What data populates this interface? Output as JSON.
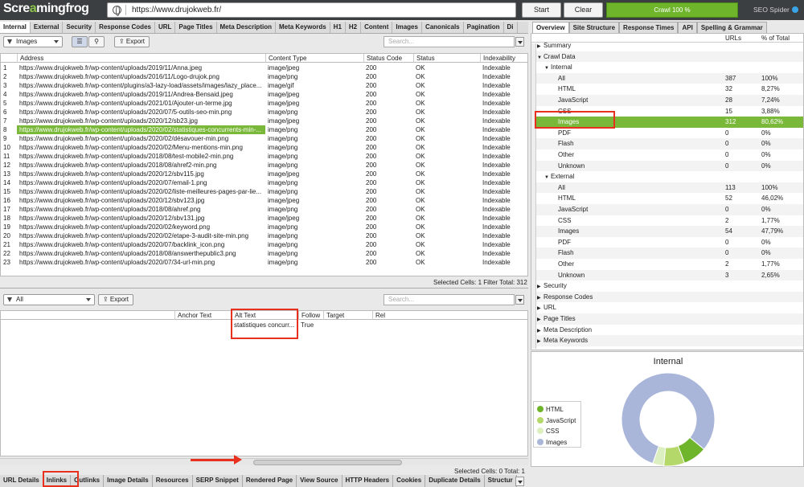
{
  "app": {
    "logo_left": "Scre",
    "logo_o": "a",
    "logo_right": "mingfrog",
    "url": "https://www.drujokweb.fr/",
    "start": "Start",
    "clear": "Clear",
    "progress": "Crawl 100 %",
    "seo_spider": "SEO Spider"
  },
  "top_tabs": [
    "Internal",
    "External",
    "Security",
    "Response Codes",
    "URL",
    "Page Titles",
    "Meta Description",
    "Meta Keywords",
    "H1",
    "H2",
    "Content",
    "Images",
    "Canonicals",
    "Pagination",
    "Di"
  ],
  "filter": {
    "value": "Images",
    "export": "Export",
    "search_placeholder": "Search..."
  },
  "columns": [
    "Address",
    "Content Type",
    "Status Code",
    "Status",
    "Indexability"
  ],
  "rows": [
    [
      "1",
      "https://www.drujokweb.fr/wp-content/uploads/2019/11/Anna.jpeg",
      "image/jpeg",
      "200",
      "OK",
      "Indexable"
    ],
    [
      "2",
      "https://www.drujokweb.fr/wp-content/uploads/2016/11/Logo-drujok.png",
      "image/png",
      "200",
      "OK",
      "Indexable"
    ],
    [
      "3",
      "https://www.drujokweb.fr/wp-content/plugins/a3-lazy-load/assets/images/lazy_place...",
      "image/gif",
      "200",
      "OK",
      "Indexable"
    ],
    [
      "4",
      "https://www.drujokweb.fr/wp-content/uploads/2019/11/Andrea-Bensaid.jpeg",
      "image/jpeg",
      "200",
      "OK",
      "Indexable"
    ],
    [
      "5",
      "https://www.drujokweb.fr/wp-content/uploads/2021/01/Ajouter-un-terme.jpg",
      "image/jpeg",
      "200",
      "OK",
      "Indexable"
    ],
    [
      "6",
      "https://www.drujokweb.fr/wp-content/uploads/2020/07/5-outils-seo-min.png",
      "image/png",
      "200",
      "OK",
      "Indexable"
    ],
    [
      "7",
      "https://www.drujokweb.fr/wp-content/uploads/2020/12/sb23.jpg",
      "image/jpeg",
      "200",
      "OK",
      "Indexable"
    ],
    [
      "8",
      "https://www.drujokweb.fr/wp-content/uploads/2020/02/statistiques-concurrents-min-...",
      "image/png",
      "200",
      "OK",
      "Indexable"
    ],
    [
      "9",
      "https://www.drujokweb.fr/wp-content/uploads/2020/02/désavouer-min.png",
      "image/png",
      "200",
      "OK",
      "Indexable"
    ],
    [
      "10",
      "https://www.drujokweb.fr/wp-content/uploads/2020/02/Menu-mentions-min.png",
      "image/png",
      "200",
      "OK",
      "Indexable"
    ],
    [
      "11",
      "https://www.drujokweb.fr/wp-content/uploads/2018/08/test-mobile2-min.png",
      "image/png",
      "200",
      "OK",
      "Indexable"
    ],
    [
      "12",
      "https://www.drujokweb.fr/wp-content/uploads/2018/08/ahref2-min.png",
      "image/png",
      "200",
      "OK",
      "Indexable"
    ],
    [
      "13",
      "https://www.drujokweb.fr/wp-content/uploads/2020/12/sbv115.jpg",
      "image/jpeg",
      "200",
      "OK",
      "Indexable"
    ],
    [
      "14",
      "https://www.drujokweb.fr/wp-content/uploads/2020/07/email-1.png",
      "image/png",
      "200",
      "OK",
      "Indexable"
    ],
    [
      "15",
      "https://www.drujokweb.fr/wp-content/uploads/2020/02/liste-meilleures-pages-par-lie...",
      "image/png",
      "200",
      "OK",
      "Indexable"
    ],
    [
      "16",
      "https://www.drujokweb.fr/wp-content/uploads/2020/12/sbv123.jpg",
      "image/jpeg",
      "200",
      "OK",
      "Indexable"
    ],
    [
      "17",
      "https://www.drujokweb.fr/wp-content/uploads/2018/08/ahref.png",
      "image/png",
      "200",
      "OK",
      "Indexable"
    ],
    [
      "18",
      "https://www.drujokweb.fr/wp-content/uploads/2020/12/sbv131.jpg",
      "image/jpeg",
      "200",
      "OK",
      "Indexable"
    ],
    [
      "19",
      "https://www.drujokweb.fr/wp-content/uploads/2020/02/keyword.png",
      "image/png",
      "200",
      "OK",
      "Indexable"
    ],
    [
      "20",
      "https://www.drujokweb.fr/wp-content/uploads/2020/02/etape-3-audit-site-min.png",
      "image/png",
      "200",
      "OK",
      "Indexable"
    ],
    [
      "21",
      "https://www.drujokweb.fr/wp-content/uploads/2020/07/backlink_icon.png",
      "image/png",
      "200",
      "OK",
      "Indexable"
    ],
    [
      "22",
      "https://www.drujokweb.fr/wp-content/uploads/2018/08/answerthepublic3.png",
      "image/png",
      "200",
      "OK",
      "Indexable"
    ],
    [
      "23",
      "https://www.drujokweb.fr/wp-content/uploads/2020/07/34-url-min.png",
      "image/png",
      "200",
      "OK",
      "Indexable"
    ]
  ],
  "selected_row": 7,
  "top_status": "Selected Cells:  1  Filter Total:  312",
  "lower": {
    "filter": "All",
    "export": "Export",
    "search_placeholder": "Search...",
    "columns": [
      "Anchor Text",
      "Alt Text",
      "Follow",
      "Target",
      "Rel"
    ],
    "row": [
      "",
      "statistiques concurr...",
      "True",
      "",
      ""
    ],
    "status": "Selected Cells:  0  Total:  1"
  },
  "right_tabs": [
    "Overview",
    "Site Structure",
    "Response Times",
    "API",
    "Spelling & Grammar"
  ],
  "overview_cols": [
    "URLs",
    "% of Total"
  ],
  "tree": [
    {
      "label": "Summary",
      "lvl": 0,
      "arrow": "▶",
      "urls": "",
      "pct": ""
    },
    {
      "label": "Crawl Data",
      "lvl": 0,
      "arrow": "▼",
      "urls": "",
      "pct": ""
    },
    {
      "label": "Internal",
      "lvl": 1,
      "arrow": "▼",
      "urls": "",
      "pct": ""
    },
    {
      "label": "All",
      "lvl": 2,
      "arrow": "",
      "urls": "387",
      "pct": "100%"
    },
    {
      "label": "HTML",
      "lvl": 2,
      "arrow": "",
      "urls": "32",
      "pct": "8,27%"
    },
    {
      "label": "JavaScript",
      "lvl": 2,
      "arrow": "",
      "urls": "28",
      "pct": "7,24%"
    },
    {
      "label": "CSS",
      "lvl": 2,
      "arrow": "",
      "urls": "15",
      "pct": "3,88%"
    },
    {
      "label": "Images",
      "lvl": 2,
      "arrow": "",
      "urls": "312",
      "pct": "80,62%"
    },
    {
      "label": "PDF",
      "lvl": 2,
      "arrow": "",
      "urls": "0",
      "pct": "0%"
    },
    {
      "label": "Flash",
      "lvl": 2,
      "arrow": "",
      "urls": "0",
      "pct": "0%"
    },
    {
      "label": "Other",
      "lvl": 2,
      "arrow": "",
      "urls": "0",
      "pct": "0%"
    },
    {
      "label": "Unknown",
      "lvl": 2,
      "arrow": "",
      "urls": "0",
      "pct": "0%"
    },
    {
      "label": "External",
      "lvl": 1,
      "arrow": "▼",
      "urls": "",
      "pct": ""
    },
    {
      "label": "All",
      "lvl": 2,
      "arrow": "",
      "urls": "113",
      "pct": "100%"
    },
    {
      "label": "HTML",
      "lvl": 2,
      "arrow": "",
      "urls": "52",
      "pct": "46,02%"
    },
    {
      "label": "JavaScript",
      "lvl": 2,
      "arrow": "",
      "urls": "0",
      "pct": "0%"
    },
    {
      "label": "CSS",
      "lvl": 2,
      "arrow": "",
      "urls": "2",
      "pct": "1,77%"
    },
    {
      "label": "Images",
      "lvl": 2,
      "arrow": "",
      "urls": "54",
      "pct": "47,79%"
    },
    {
      "label": "PDF",
      "lvl": 2,
      "arrow": "",
      "urls": "0",
      "pct": "0%"
    },
    {
      "label": "Flash",
      "lvl": 2,
      "arrow": "",
      "urls": "0",
      "pct": "0%"
    },
    {
      "label": "Other",
      "lvl": 2,
      "arrow": "",
      "urls": "2",
      "pct": "1,77%"
    },
    {
      "label": "Unknown",
      "lvl": 2,
      "arrow": "",
      "urls": "3",
      "pct": "2,65%"
    },
    {
      "label": "Security",
      "lvl": 0,
      "arrow": "▶",
      "urls": "",
      "pct": ""
    },
    {
      "label": "Response Codes",
      "lvl": 0,
      "arrow": "▶",
      "urls": "",
      "pct": ""
    },
    {
      "label": "URL",
      "lvl": 0,
      "arrow": "▶",
      "urls": "",
      "pct": ""
    },
    {
      "label": "Page Titles",
      "lvl": 0,
      "arrow": "▶",
      "urls": "",
      "pct": ""
    },
    {
      "label": "Meta Description",
      "lvl": 0,
      "arrow": "▶",
      "urls": "",
      "pct": ""
    },
    {
      "label": "Meta Keywords",
      "lvl": 0,
      "arrow": "▶",
      "urls": "",
      "pct": ""
    }
  ],
  "tree_selected": 7,
  "chart_data": {
    "type": "pie",
    "title": "Internal",
    "categories": [
      "HTML",
      "JavaScript",
      "CSS",
      "Images"
    ],
    "values": [
      32,
      28,
      15,
      312
    ],
    "colors": [
      "#6fb52c",
      "#b5d86a",
      "#dcefc0",
      "#a9b6d9"
    ],
    "legend": "left"
  },
  "bottom_tabs": [
    "URL Details",
    "Inlinks",
    "Outlinks",
    "Image Details",
    "Resources",
    "SERP Snippet",
    "Rendered Page",
    "View Source",
    "HTTP Headers",
    "Cookies",
    "Duplicate Details",
    "Structur"
  ]
}
